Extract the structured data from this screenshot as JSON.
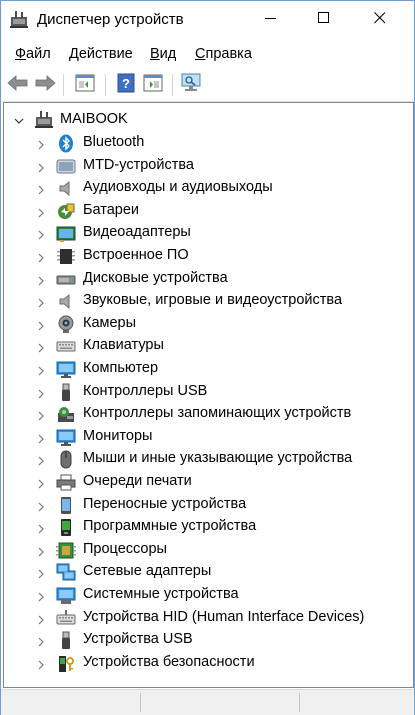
{
  "window": {
    "title": "Диспетчер устройств",
    "icons": [
      "device-manager-icon",
      "minimize-icon",
      "maximize-icon",
      "close-icon"
    ]
  },
  "menu": [
    {
      "label": "Файл",
      "hotkey": "Ф"
    },
    {
      "label": "Действие",
      "hotkey": "Д"
    },
    {
      "label": "Вид",
      "hotkey": "В"
    },
    {
      "label": "Справка",
      "hotkey": "С"
    }
  ],
  "toolbar": {
    "icons": [
      "back-arrow-icon",
      "forward-arrow-icon",
      "properties-icon",
      "help-icon",
      "update-driver-icon",
      "scan-hardware-icon"
    ]
  },
  "tree": {
    "root": "MAIBOOK",
    "categories": [
      {
        "label": "Bluetooth",
        "icon": "bluetooth-icon"
      },
      {
        "label": "MTD-устройства",
        "icon": "mtd-device-icon"
      },
      {
        "label": "Аудиовходы и аудиовыходы",
        "icon": "speaker-icon"
      },
      {
        "label": "Батареи",
        "icon": "battery-icon"
      },
      {
        "label": "Видеоадаптеры",
        "icon": "display-adapter-icon"
      },
      {
        "label": "Встроенное ПО",
        "icon": "firmware-icon"
      },
      {
        "label": "Дисковые устройства",
        "icon": "disk-drive-icon"
      },
      {
        "label": "Звуковые, игровые и видеоустройства",
        "icon": "sound-device-icon"
      },
      {
        "label": "Камеры",
        "icon": "camera-icon"
      },
      {
        "label": "Клавиатуры",
        "icon": "keyboard-icon"
      },
      {
        "label": "Компьютер",
        "icon": "computer-icon"
      },
      {
        "label": "Контроллеры USB",
        "icon": "usb-controller-icon"
      },
      {
        "label": "Контроллеры запоминающих устройств",
        "icon": "storage-controller-icon"
      },
      {
        "label": "Мониторы",
        "icon": "monitor-icon"
      },
      {
        "label": "Мыши и иные указывающие устройства",
        "icon": "mouse-icon"
      },
      {
        "label": "Очереди печати",
        "icon": "printer-icon"
      },
      {
        "label": "Переносные устройства",
        "icon": "portable-device-icon"
      },
      {
        "label": "Программные устройства",
        "icon": "software-device-icon"
      },
      {
        "label": "Процессоры",
        "icon": "processor-icon"
      },
      {
        "label": "Сетевые адаптеры",
        "icon": "network-adapter-icon"
      },
      {
        "label": "Системные устройства",
        "icon": "system-device-icon"
      },
      {
        "label": "Устройства HID (Human Interface Devices)",
        "icon": "hid-icon"
      },
      {
        "label": "Устройства USB",
        "icon": "usb-device-icon"
      },
      {
        "label": "Устройства безопасности",
        "icon": "security-device-icon"
      }
    ]
  },
  "colors": {
    "accent": "#0078d7",
    "icon_blue": "#3c8fd8",
    "icon_gray": "#7a7a7a"
  }
}
